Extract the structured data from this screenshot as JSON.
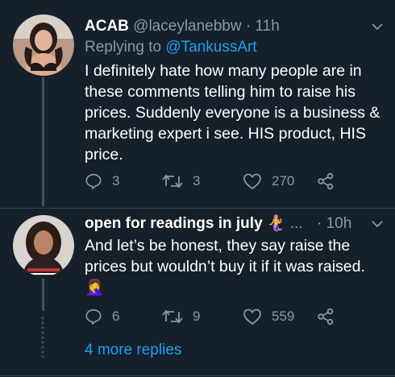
{
  "tweets": [
    {
      "display_name": "ACAB",
      "handle": "@laceylanebbw",
      "separator": "·",
      "time": "11h",
      "replying_prefix": "Replying to",
      "replying_handle": "@TankussArt",
      "text": "I definitely hate how many people are in these comments telling him to raise his prices. Suddenly everyone is a business & marketing expert i see. HIS product, HIS price.",
      "replies": "3",
      "retweets": "3",
      "likes": "270"
    },
    {
      "display_name": "open for readings in july",
      "name_emoji": "🧜‍♀️",
      "ellipsis": "...",
      "separator": "·",
      "time": "10h",
      "text": "And let’s be honest, they say raise the prices but wouldn’t buy it if it was raised.",
      "emoji": "🤦‍♀️",
      "replies": "6",
      "retweets": "9",
      "likes": "559"
    }
  ],
  "more_replies": "4 more replies",
  "colors": {
    "background": "#15202b",
    "muted": "#8899a6",
    "accent": "#1da1f2",
    "thread_line": "#3d5466"
  },
  "icons": [
    "chevron-down-icon",
    "reply-icon",
    "retweet-icon",
    "like-icon",
    "share-icon"
  ]
}
